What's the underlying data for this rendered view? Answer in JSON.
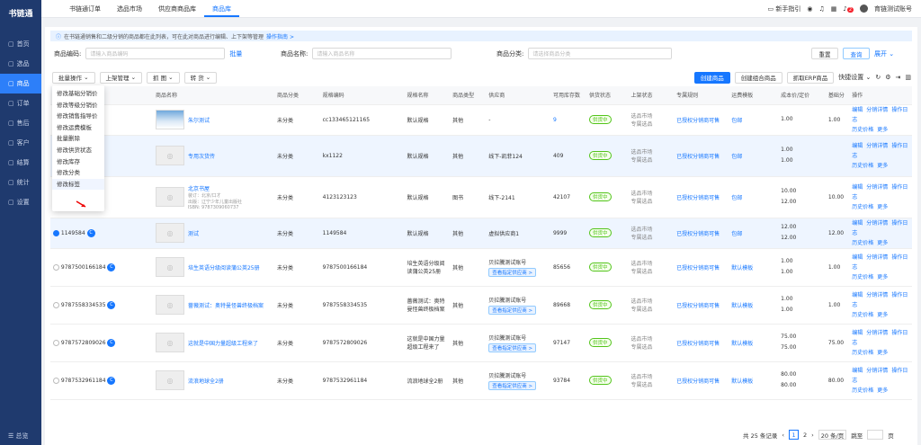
{
  "app": {
    "logo": "书链通"
  },
  "sidebar": {
    "items": [
      {
        "label": "首页",
        "icon": "monitor-icon"
      },
      {
        "label": "选品",
        "icon": "grid-icon"
      },
      {
        "label": "商品",
        "icon": "box-icon"
      },
      {
        "label": "订单",
        "icon": "order-icon"
      },
      {
        "label": "售后",
        "icon": "aftersale-icon"
      },
      {
        "label": "客户",
        "icon": "customer-icon"
      },
      {
        "label": "结算",
        "icon": "settle-icon"
      },
      {
        "label": "统计",
        "icon": "stats-icon"
      },
      {
        "label": "设置",
        "icon": "settings-icon"
      }
    ],
    "footer": "总览"
  },
  "topnav": {
    "tabs": [
      "书链通订单",
      "选品市场",
      "供应商商品库",
      "商品库"
    ],
    "active": 3,
    "guide": "新手指引",
    "user": "育链测试账号",
    "badge": "2"
  },
  "notice": {
    "text": "在书链通销售和二级分销的商品都在此列表，可在此对商品进行编辑、上下架等管理",
    "link": "操作指南 >"
  },
  "filters": {
    "code_label": "商品编码:",
    "code_ph": "请输入商品编码",
    "batch": "批量",
    "name_label": "商品名称:",
    "name_ph": "请输入商品名称",
    "cat_label": "商品分类:",
    "cat_ph": "请选择商品分类",
    "reset": "重置",
    "query": "查询",
    "expand": "展开"
  },
  "toolbar": {
    "batch_op": "批量操作",
    "onoff": "上架管理",
    "grab": "抓 图",
    "transfer": "转 货",
    "create": "创建商品",
    "create_combo": "创建组合商品",
    "erp": "抓取ERP商品",
    "quick": "快捷设置"
  },
  "dropdown": [
    "修改基础分销价",
    "修改等级分销价",
    "修改销售指导价",
    "修改运费模板",
    "批量删除",
    "修改供货状态",
    "修改库存",
    "修改分类",
    "修改标签"
  ],
  "columns": [
    "",
    "商品名称",
    "",
    "商品分类",
    "规格编码",
    "规格名称",
    "商品类型",
    "供应商",
    "可用库存数",
    "供货状态",
    "上架状态",
    "专属规则",
    "运费模板",
    "成本价/定价",
    "基础分",
    "操作"
  ],
  "rows": [
    {
      "id": "",
      "name": "朱尔测试",
      "cat": "未分类",
      "sku": "cc133465121165",
      "spec": "默认规格",
      "type": "其他",
      "sup": "-",
      "stock": "9",
      "status": "供货中",
      "sale": [
        "选品市场",
        "专属选品"
      ],
      "rule": "已授权分销商可售",
      "ship": "包邮",
      "price": [
        "",
        "1.00"
      ],
      "base": "1.00",
      "ic": "g",
      "sel": false,
      "img": "photo"
    },
    {
      "id": "",
      "name": "专用次货传",
      "cat": "未分类",
      "sku": "kx1122",
      "spec": "默认规格",
      "type": "其他",
      "sup": "线下-凯菲124",
      "stock": "409",
      "status": "供货中",
      "sale": [
        "选品市场",
        "专属选品"
      ],
      "rule": "已授权分销商可售",
      "ship": "包邮",
      "price": [
        "1.00",
        "1.00"
      ],
      "base": "",
      "sel": true
    },
    {
      "id": "",
      "name": "北京书屋",
      "cat": "未分类",
      "sku": "4123123123",
      "spec": "默认规格",
      "type": "图书",
      "sup": "线下-2141",
      "stock": "42107",
      "status": "供货中",
      "sale": [
        "选品市场",
        "专属选品"
      ],
      "rule": "已授权分销商可售",
      "ship": "包邮",
      "price": [
        "10.00",
        "12.00"
      ],
      "base": "10.00",
      "sel": false,
      "book": [
        "装订：北京/口才",
        "出版：辽宁少年儿童出版社",
        "ISBN: 9787309060737"
      ]
    },
    {
      "id": "1149584",
      "name": "测试",
      "cat": "未分类",
      "sku": "1149584",
      "spec": "默认规格",
      "type": "其他",
      "sup": "虚拟供应商1",
      "stock": "9999",
      "status": "供货中",
      "sale": [
        "选品市场",
        "专属选品"
      ],
      "rule": "已授权分销商可售",
      "ship": "包邮",
      "price": [
        "12.00",
        "12.00"
      ],
      "base": "12.00",
      "sel": true,
      "checked": true
    },
    {
      "id": "9787500166184",
      "name": "培生英语分级阅读蒲公英25册",
      "cat": "未分类",
      "sku": "9787500166184",
      "spec": "培生英语分级阅读蒲公英25册",
      "type": "其他",
      "sup": "贝拉騰测试账号",
      "supbtn": "查看指定供应商 >",
      "stock": "85656",
      "status": "供货中",
      "sale": [
        "选品市场",
        "专属选品"
      ],
      "rule": "已授权分销商可售",
      "ship": "默认模板",
      "price": [
        "1.00",
        "1.00"
      ],
      "base": "1.00",
      "sel": false
    },
    {
      "id": "9787558334535",
      "name": "蔷薇测试：奥特曼怪兽终极档案",
      "cat": "未分类",
      "sku": "9787558334535",
      "spec": "蔷薇测试：奥特曼怪兽终极档案",
      "type": "其他",
      "sup": "贝拉騰测试账号",
      "supbtn": "查看指定供应商 >",
      "stock": "89668",
      "status": "供货中",
      "sale": [
        "选品市场",
        "专属选品"
      ],
      "rule": "已授权分销商可售",
      "ship": "默认模板",
      "price": [
        "1.00",
        "1.00"
      ],
      "base": "1.00",
      "sel": false
    },
    {
      "id": "9787572809026",
      "name": "这就是中国力量超级工程来了",
      "cat": "未分类",
      "sku": "9787572809026",
      "spec": "这就是中国力量超级工程来了",
      "type": "其他",
      "sup": "贝拉騰测试账号",
      "supbtn": "查看指定供应商 >",
      "stock": "97147",
      "status": "供货中",
      "sale": [
        "选品市场",
        "专属选品"
      ],
      "rule": "已授权分销商可售",
      "ship": "默认模板",
      "price": [
        "75.00",
        "75.00"
      ],
      "base": "75.00",
      "sel": false
    },
    {
      "id": "9787532961184",
      "name": "流浪地球全2册",
      "cat": "未分类",
      "sku": "9787532961184",
      "spec": "流浪地球全2册",
      "type": "其他",
      "sup": "贝拉騰测试账号",
      "supbtn": "查看指定供应商 >",
      "stock": "93784",
      "status": "供货中",
      "sale": [
        "选品市场",
        "专属选品"
      ],
      "rule": "已授权分销商可售",
      "ship": "默认模板",
      "price": [
        "80.00",
        "80.00"
      ],
      "base": "80.00",
      "sel": false
    }
  ],
  "ops": [
    "编辑",
    "分销详情",
    "操作日志",
    "历史价格",
    "更多"
  ],
  "pager": {
    "total": "共 25 条记录",
    "pages": [
      "1",
      "2"
    ],
    "size": "20 条/页",
    "goto": "跳至",
    "page_unit": "页"
  }
}
